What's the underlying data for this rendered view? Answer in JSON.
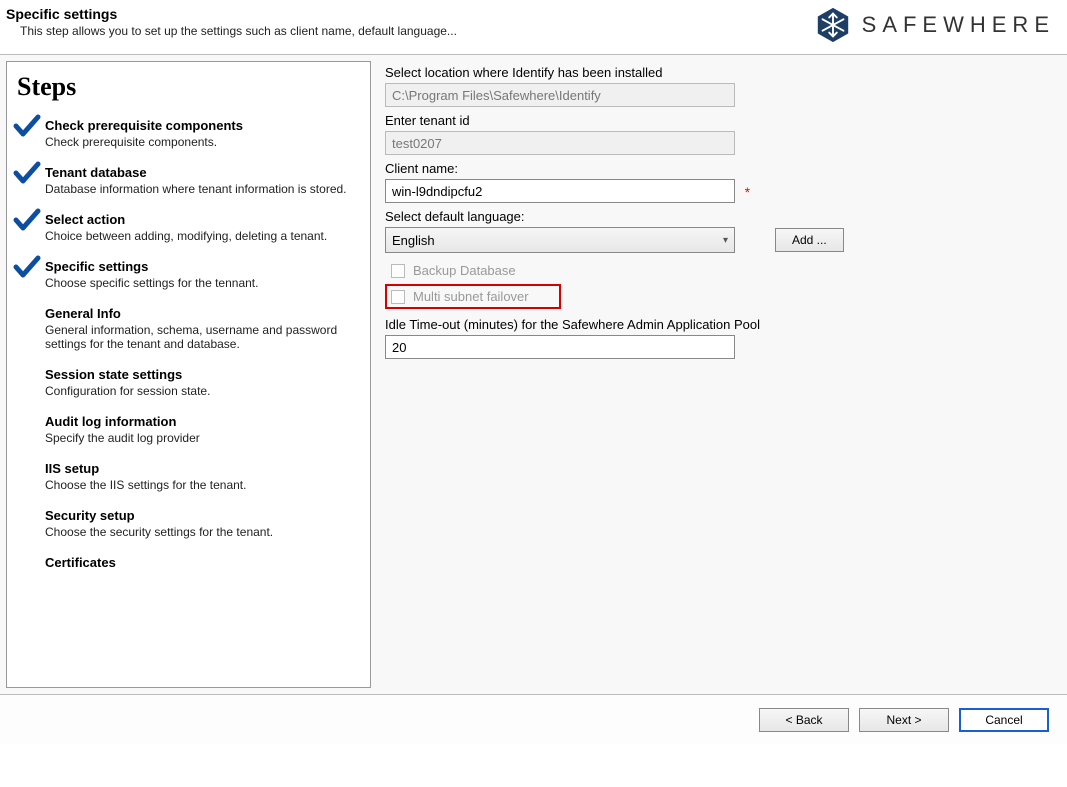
{
  "header": {
    "title": "Specific settings",
    "subtitle": "This step allows you to set up the settings such as client name, default language..."
  },
  "brand": {
    "name": "SAFEWHERE"
  },
  "steps_title": "Steps",
  "steps": [
    {
      "title": "Check prerequisite components",
      "desc": "Check prerequisite components.",
      "checked": true
    },
    {
      "title": "Tenant database",
      "desc": "Database information where tenant information is stored.",
      "checked": true
    },
    {
      "title": "Select action",
      "desc": "Choice between adding, modifying, deleting a tenant.",
      "checked": true
    },
    {
      "title": "Specific settings",
      "desc": "Choose specific settings for the tennant.",
      "checked": true
    },
    {
      "title": "General Info",
      "desc": "General information, schema, username and password settings for the tenant and database.",
      "checked": false
    },
    {
      "title": "Session state settings",
      "desc": "Configuration for session state.",
      "checked": false
    },
    {
      "title": "Audit log information",
      "desc": "Specify the audit log provider",
      "checked": false
    },
    {
      "title": "IIS setup",
      "desc": "Choose the IIS settings for the tenant.",
      "checked": false
    },
    {
      "title": "Security setup",
      "desc": "Choose the security settings for the tenant.",
      "checked": false
    },
    {
      "title": "Certificates",
      "desc": "",
      "checked": false
    }
  ],
  "form": {
    "location_label": "Select location where Identify has been installed",
    "location_value": "C:\\Program Files\\Safewhere\\Identify",
    "tenant_label": "Enter tenant id",
    "tenant_value": "test0207",
    "client_label": "Client name:",
    "client_value": "win-l9dndipcfu2",
    "lang_label": "Select default language:",
    "lang_value": "English",
    "add_btn": "Add ...",
    "backup_label": "Backup Database",
    "failover_label": "Multi subnet failover",
    "idle_label": "Idle Time-out (minutes) for the Safewhere Admin Application Pool",
    "idle_value": "20",
    "required_mark": "*"
  },
  "footer": {
    "back": "< Back",
    "next": "Next >",
    "cancel": "Cancel"
  }
}
